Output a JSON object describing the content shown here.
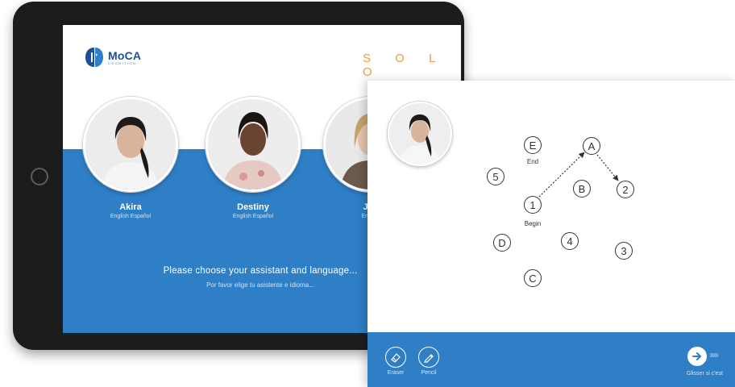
{
  "back_screen": {
    "logo": {
      "name": "MoCA",
      "subtitle": "COGNITION"
    },
    "mode_label": "S O L O",
    "assistants": [
      {
        "name": "Akira",
        "languages": "English  Español"
      },
      {
        "name": "Destiny",
        "languages": "English  Español"
      },
      {
        "name": "Jan",
        "languages": "English"
      }
    ],
    "prompt": "Please choose your assistant and language...",
    "prompt_es": "Por favor elige tu asistente e idioma..."
  },
  "trail_test": {
    "nodes": [
      {
        "id": "E",
        "label": "E",
        "caption": "End"
      },
      {
        "id": "A",
        "label": "A"
      },
      {
        "id": "5",
        "label": "5"
      },
      {
        "id": "B",
        "label": "B"
      },
      {
        "id": "2",
        "label": "2"
      },
      {
        "id": "1",
        "label": "1",
        "caption": "Begin"
      },
      {
        "id": "D",
        "label": "D"
      },
      {
        "id": "4",
        "label": "4"
      },
      {
        "id": "3",
        "label": "3"
      },
      {
        "id": "C",
        "label": "C"
      }
    ],
    "drawn_path": [
      "1",
      "A",
      "2"
    ]
  },
  "toolbar": {
    "eraser_label": "Eraser",
    "pencil_label": "Pencil",
    "next_label": "Glisser si c'est"
  },
  "colors": {
    "brand_blue": "#2e7fc6",
    "logo_navy": "#1e4f9a",
    "solo_orange": "#ef9a3a"
  },
  "icons": {
    "eraser": "eraser-icon",
    "pencil": "pencil-icon",
    "next": "arrow-right-icon"
  }
}
